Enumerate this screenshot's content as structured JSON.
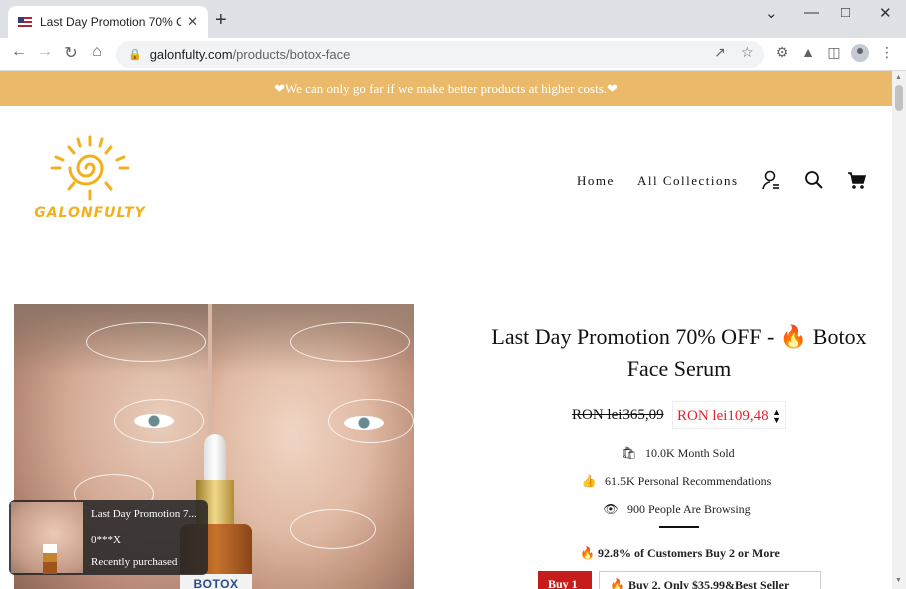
{
  "browser": {
    "tab_title": "Last Day Promotion 70% OFF - 🔥",
    "tab_close": "✕",
    "new_tab": "+",
    "url_domain": "galonfulty.com",
    "url_path": "/products/botox-face",
    "controls": {
      "minimize": "—",
      "maximize": "□",
      "close": "✕",
      "tab_list": "⌄"
    }
  },
  "site": {
    "banner_text": "❤We can only go far if we make better products at higher costs.❤",
    "logo_text": "GALONFULTY",
    "nav": {
      "home": "Home",
      "collections": "All Collections"
    }
  },
  "product": {
    "title_line1": "Last Day Promotion 70% OFF -",
    "title_flame": "🔥",
    "title_rest": "Botox",
    "title_line2": "Face Serum",
    "old_price": "RON lei365,09",
    "new_price": "RON lei109,48",
    "image_label": "BOTOX",
    "stats": [
      {
        "icon": "bag-icon",
        "text": "10.0K Month Sold"
      },
      {
        "icon": "thumbs-up-icon",
        "text": "61.5K Personal Recommendations"
      },
      {
        "icon": "eye-icon",
        "text": "900 People Are Browsing"
      }
    ],
    "bundle_note": "92.8% of Customers Buy 2 or More",
    "options": {
      "buy1": "Buy 1",
      "buy2": "Buy 2, Only $35.99&Best Seller"
    }
  },
  "popup": {
    "title": "Last Day Promotion 7...",
    "buyer": "0***X",
    "status": "Recently purchased"
  },
  "colors": {
    "banner": "#eab96a",
    "logo": "#f2b01e",
    "price": "#e3232d",
    "buy1": "#c71c1c"
  }
}
